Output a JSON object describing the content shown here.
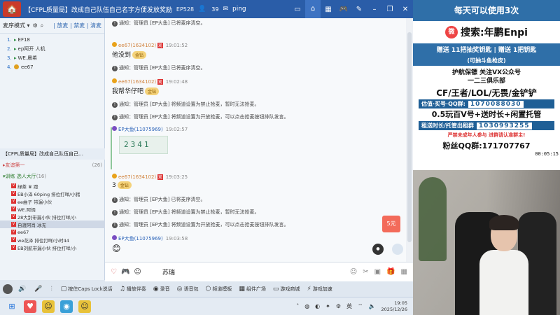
{
  "titlebar": {
    "title": "【CFPL质量局】改成自己队伍自己名字方便发放奖励",
    "channel": "EP528",
    "online": "39",
    "icons": [
      "user-icon",
      "mail-icon",
      "ping-icon",
      "home-icon",
      "grid-icon",
      "gamepad-icon",
      "minimize-icon",
      "restore-icon",
      "close-icon"
    ]
  },
  "leftpanel": {
    "mic_mode": "麦序模式 ▾",
    "mic_links": "| 放麦 | 禁麦 | 清麦",
    "mic_list": [
      {
        "num": "1.",
        "name": "EF18"
      },
      {
        "num": "2.",
        "name": "ep阿开 人机"
      },
      {
        "num": "3.",
        "name": "WE.晨希"
      },
      {
        "num": "4.",
        "name": "ee67"
      }
    ],
    "clan_row": "【CFPL质量局】改成自己队伍自己…",
    "friend_row": "友谊第一",
    "friend_count": "(26)",
    "hall_row": "训练 选人大厅",
    "hall_count": "(16)",
    "members": [
      "绿茶 ♛ 蹬",
      "EB小泽 60ping 排位打咩/小猪",
      "ee曲子 带漏小伙",
      "WE.阿炳",
      "28大别带漏小伙 排位打咩/小",
      "自渡阿肖 冰无",
      "ee67",
      "we花泽 排位打咩/小时44",
      "EB刘航带漏小伙 排位打咩/小"
    ]
  },
  "chat": {
    "msg1": "通知：管理员 [EP大鱼] 已将麦序清空。",
    "u1_name": "ee67(1634102)",
    "u1_tag": "观",
    "u1_time": "19:01:52",
    "u1_text": "他没到",
    "gift": "金钻",
    "msg2": "通知：管理员 [EP大鱼] 已将麦序清空。",
    "u2_name": "ee67(1634102)",
    "u2_tag": "观",
    "u2_time": "19:02:48",
    "u2_text": "我帮华仔吧",
    "msg3": "通知：管理员 [EP大鱼] 将频道设置为禁止抢麦，暂时无法抢麦。",
    "msg4": "通知：管理员 [EP大鱼] 将频道设置为开放抢麦，可以点击抢麦按钮排队发言。",
    "u3_name": "EP大鱼(11075969)",
    "u3_time": "19:02:57",
    "code": "2341",
    "u4_name": "ee67(1634102)",
    "u4_tag": "观",
    "u4_time": "19:03:25",
    "u4_text": "3",
    "msg5": "通知：管理员 [EP大鱼] 已将麦序清空。",
    "msg6": "通知：管理员 [EP大鱼] 将频道设置为禁止抢麦，暂时无法抢麦。",
    "msg7": "通知：管理员 [EP大鱼] 将频道设置为开放抢麦，可以点击抢麦按钮排队发言。",
    "u5_name": "EP大鱼(11075969)",
    "u5_time": "19:03:58",
    "redpack": "5元"
  },
  "input": {
    "text": "苏瑞"
  },
  "toolbar": {
    "caps": "按住Caps Lock说话",
    "accompany": "播放伴奏",
    "record": "录音",
    "voicepack": "语音包",
    "channel_tpl": "频道模板",
    "widget": "组件广场",
    "shop": "游戏商城",
    "accel": "游戏加速"
  },
  "taskbar": {
    "ime": "英",
    "time": "19:05",
    "date": "2025/12/26"
  },
  "stream": {
    "top_banner": "每天可以使用3次",
    "search": "搜索:年鹏Enpi",
    "gift_line": "赠送 11把抽奖钥匙 | 赠送 1把钥匙",
    "gift_sub": "(可抽斗鱼枪皮)",
    "guard": "护航保镖 关注VX公众号",
    "club": "一二三俱乐部",
    "games": "CF/王者/LOL/无畏/金铲铲",
    "price_label": "估值·买号·QQ群:",
    "price_qq": "1070088030",
    "offer": "0.5玩百V号+送时长+闲置托管",
    "rent_label": "租送时长/托管出租群",
    "rent_qq": "1030993255",
    "warn": "严禁未成年人参与 进群请认准群主!",
    "fans": "粉丝QQ群:171707767",
    "timer": "00:05:15"
  }
}
